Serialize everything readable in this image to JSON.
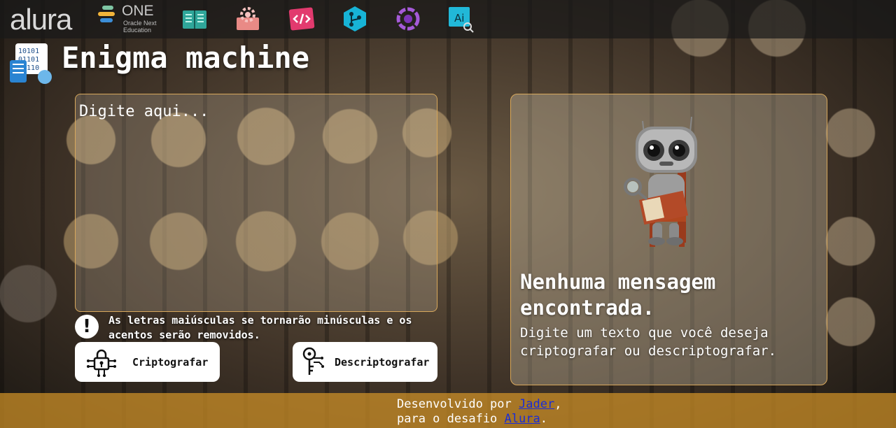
{
  "nav": {
    "brand": "alura",
    "one_logo": {
      "word": "ONE",
      "subtitle": "Oracle Next Education"
    },
    "icons": [
      "map-book-icon",
      "gear-book-icon",
      "code-tag-icon",
      "git-branch-icon",
      "openai-icon",
      "ai-search-icon"
    ]
  },
  "header": {
    "title": "Enigma machine",
    "icon": "binary-code-icon"
  },
  "input": {
    "placeholder": "Digite aqui..."
  },
  "warning": {
    "icon": "exclamation-icon",
    "text": "As letras maiúsculas se tornarão minúsculas e os acentos serão removidos."
  },
  "buttons": {
    "encrypt": {
      "label": "Criptografar",
      "icon": "lock-circuit-icon"
    },
    "decrypt": {
      "label": "Descriptografar",
      "icon": "key-circuit-icon"
    }
  },
  "output": {
    "image": "reading-robot-illustration",
    "title": "Nenhuma mensagem encontrada.",
    "text": "Digite um texto que você deseja criptografar ou descriptografar."
  },
  "footer": {
    "line1_prefix": "Desenvolvido por ",
    "author": "Jader",
    "line1_suffix": ",",
    "line2_prefix": "para o desafio ",
    "challenge": "Alura",
    "line2_suffix": "."
  },
  "colors": {
    "panel_border": "#d8a85c",
    "footer": "#d6962880",
    "link": "#1a2dd6"
  }
}
